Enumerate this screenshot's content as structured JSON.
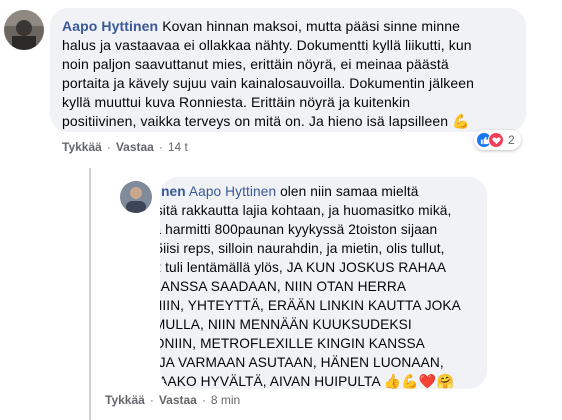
{
  "comments": [
    {
      "author": "Aapo Hyttinen",
      "text": "Kovan hinnan maksoi, mutta pääsi sinne minne\nhalus ja vastaavaa ei ollakkaa nähty. Dokumentti kyllä liikutti, kun\nnoin paljon saavuttanut mies, erittäin nöyrä, ei meinaa päästä\nportaita ja kävely sujuu vain kainalosauvoilla. Dokumentin jälkeen\nkyllä muuttui kuva Ronniesta. Erittäin nöyrä ja kuitenkin\npositiivinen, vaikka terveys on mitä on. Ja hieno isä lapsilleen",
      "emoji": "💪",
      "like_label": "Tykkää",
      "reply_label": "Vastaa",
      "time": "14 t",
      "reaction_count": "2",
      "reaction_icons": [
        "like-icon",
        "love-icon"
      ]
    },
    {
      "author": "Ana Salminen",
      "mention": "Aapo Hyttinen",
      "first_line_rest": "olen niin samaa mieltä",
      "text": "kanssasi, sitä rakkautta lajia kohtaan, ja huomasitko mikä,\nkuningasta harmitti 800paunan kyykyssä 2toiston sijaan\nolisi tullut 5iisi reps, silloin naurahdin, ja mietin, olis tullut,\nkoska ne 2 tuli lentämällä ylös, JA KUN JOSKUS RAHAA\nVAIMON KANSSA SAADAAN, NIIN OTAN HERRA\nCOLEMANIIN, YHTEYTTÄ, ERÄÄN LINKIN KAUTTA JOKA\nON VAIN MULLA, NIIN MENNÄÄN KUUKSUDEKSI\nARLINGTONIIN, METROFLEXILLE KINGIN KANSSA\nREENAA, JA VARMAAN ASUTAAN, HÄNEN LUONAAN,\nKUULOSTAAKO HYVÄLTÄ, AIVAN HUIPULTA",
      "emojis": "👍💪❤️🤗",
      "like_label": "Tykkää",
      "reply_label": "Vastaa",
      "time": "8 min"
    }
  ],
  "separator": "·",
  "colors": {
    "bubble": "#f0f2f5",
    "link": "#385898",
    "meta": "#65676b",
    "like": "#1877f2",
    "love": "#f33e58"
  }
}
